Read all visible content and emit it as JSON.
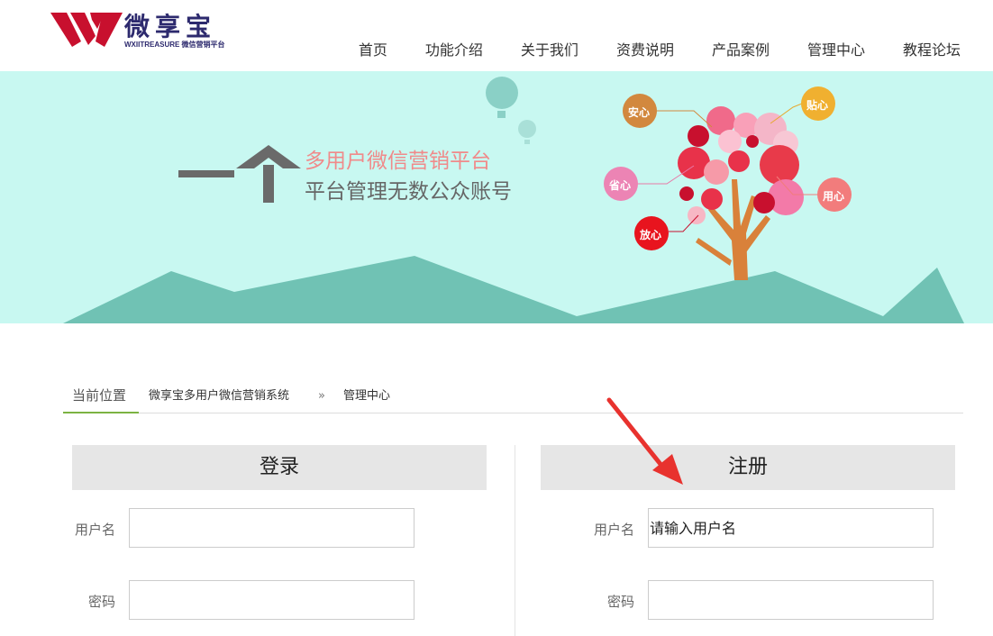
{
  "header": {
    "logo_name": "微享宝",
    "logo_sub": "WXIITREASURE 微信营销平台",
    "nav": [
      "首页",
      "功能介绍",
      "关于我们",
      "资费说明",
      "产品案例",
      "管理中心",
      "教程论坛"
    ]
  },
  "banner": {
    "slogan_line1": "多用户微信营销平台",
    "slogan_line2": "平台管理无数公众账号",
    "bubbles": [
      "安心",
      "贴心",
      "省心",
      "用心",
      "放心"
    ]
  },
  "breadcrumb": {
    "current_label": "当前位置",
    "items": [
      "微享宝多用户微信营销系统",
      "»",
      "管理中心"
    ]
  },
  "login": {
    "title": "登录",
    "username_label": "用户名",
    "password_label": "密码",
    "username_value": "",
    "password_value": ""
  },
  "register": {
    "title": "注册",
    "username_label": "用户名",
    "password_label": "密码",
    "username_placeholder": "请输入用户名",
    "password_value": ""
  },
  "colors": {
    "brand": "#2d2a6e",
    "logo_red": "#c8102e",
    "banner_bg": "#c8f8f1",
    "mountain": "#70c2b4",
    "breadcrumb_accent": "#7cb342",
    "annotation_arrow": "#e8322e"
  }
}
